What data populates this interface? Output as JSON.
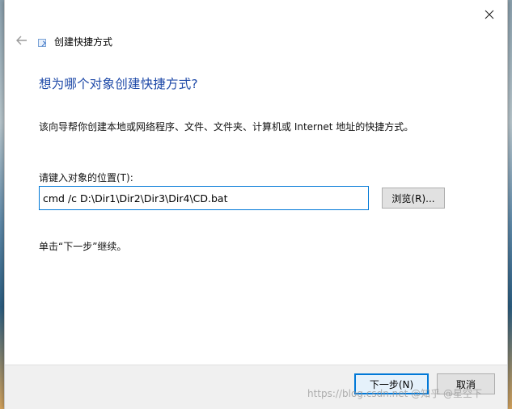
{
  "window": {
    "close_glyph": "✕"
  },
  "wizard": {
    "title": "创建快捷方式",
    "back_glyph": "←",
    "heading": "想为哪个对象创建快捷方式?",
    "description": "该向导帮你创建本地或网络程序、文件、文件夹、计算机或 Internet 地址的快捷方式。",
    "location_label": "请键入对象的位置(T):",
    "location_value": "cmd /c D:\\Dir1\\Dir2\\Dir3\\Dir4\\CD.bat",
    "browse_label": "浏览(R)...",
    "hint": "单击“下一步”继续。"
  },
  "footer": {
    "next_label": "下一步(N)",
    "cancel_label": "取消"
  },
  "watermark": "https://blog.csdn.net @知乎 @星空下",
  "colors": {
    "heading": "#1f4aa8",
    "accent": "#0078d7"
  }
}
